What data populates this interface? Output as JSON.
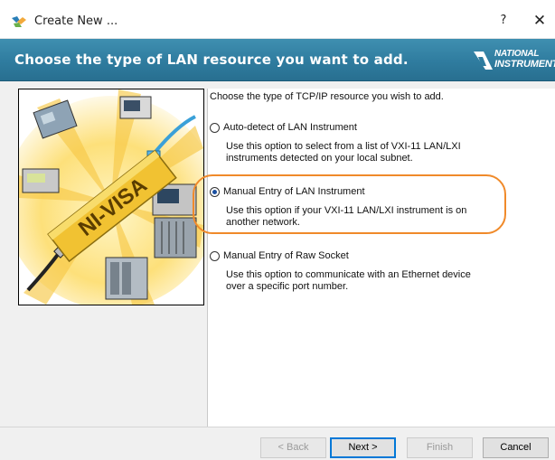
{
  "window": {
    "title": "Create New ...",
    "help_label": "?",
    "close_label": "✕"
  },
  "banner": {
    "heading": "Choose the type of LAN resource you want to add.",
    "logo_line1": "NATIONAL",
    "logo_line2": "INSTRUMENTS"
  },
  "image": {
    "product_label": "NI-VISA"
  },
  "options": {
    "intro": "Choose the type of TCP/IP resource you wish to add.",
    "items": [
      {
        "label": "Auto-detect of LAN Instrument",
        "desc_line1": "Use this option to select from a list of VXI-11 LAN/LXI",
        "desc_line2": "instruments detected on your local subnet.",
        "checked": false
      },
      {
        "label": "Manual Entry of LAN Instrument",
        "desc_line1": "Use this option if your VXI-11 LAN/LXI instrument is on",
        "desc_line2": "another network.",
        "checked": true
      },
      {
        "label": "Manual Entry of Raw Socket",
        "desc_line1": "Use this option to communicate with an Ethernet device",
        "desc_line2": "over a specific port number.",
        "checked": false
      }
    ]
  },
  "footer": {
    "back_label": "< Back",
    "next_label": "Next >",
    "finish_label": "Finish",
    "cancel_label": "Cancel"
  },
  "colors": {
    "banner": "#2f7c9f",
    "highlight": "#f08a2a",
    "radio_selected": "#1a4fa0"
  }
}
